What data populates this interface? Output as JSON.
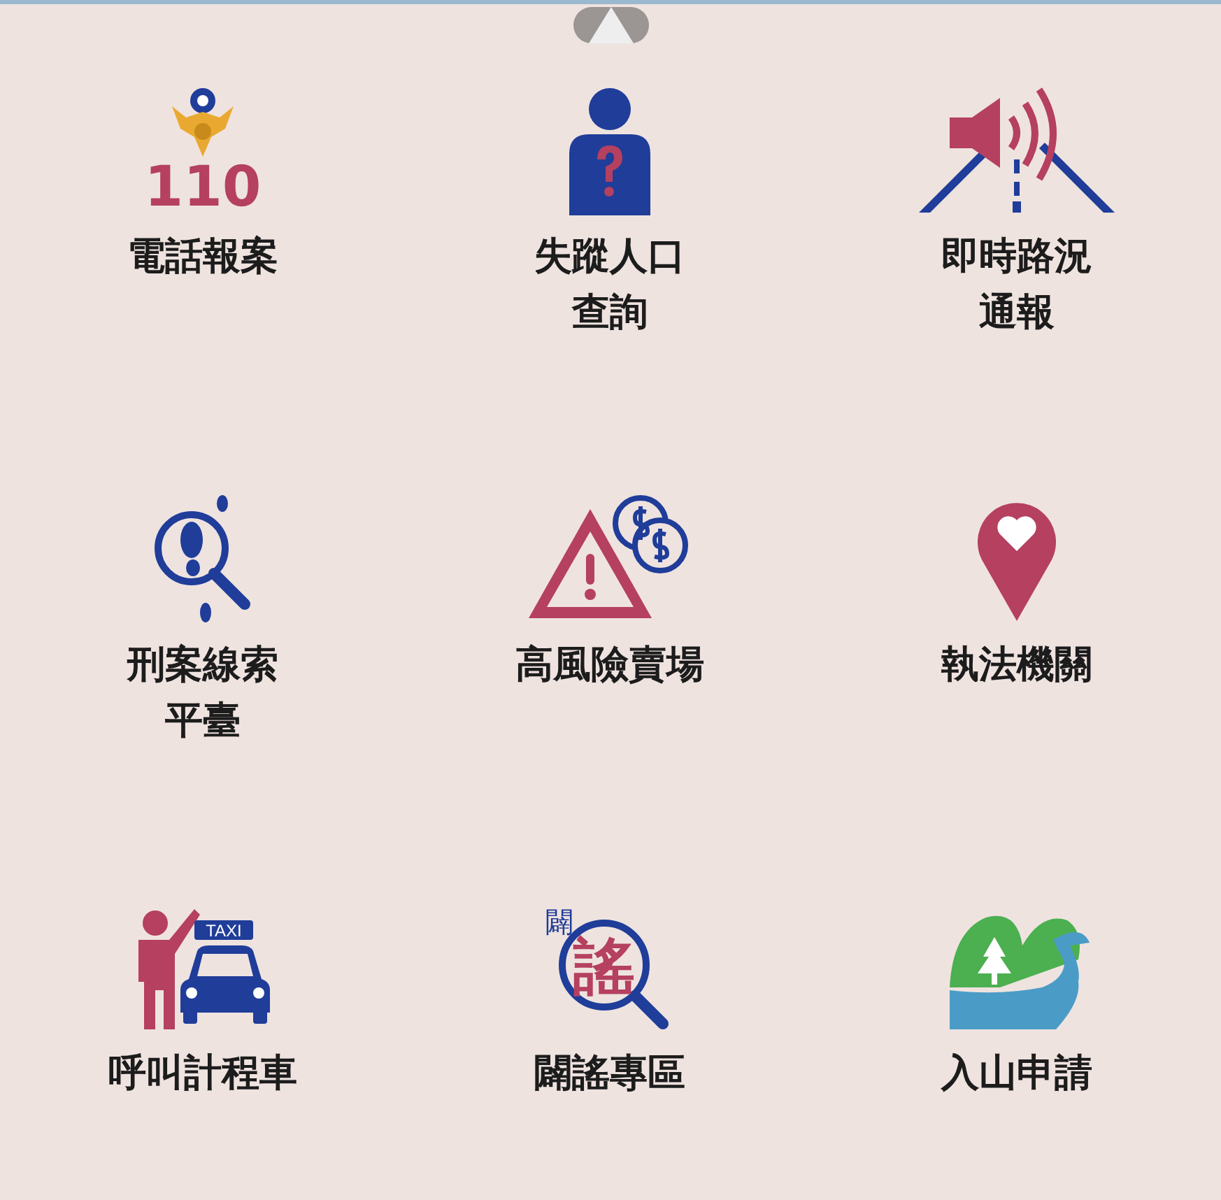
{
  "services": [
    {
      "kind": "police",
      "label": [
        "電話報案"
      ],
      "icon_text": [
        "110"
      ]
    },
    {
      "kind": "missing",
      "label": [
        "失蹤人口",
        "查詢"
      ]
    },
    {
      "kind": "traffic",
      "label": [
        "即時路況",
        "通報"
      ]
    },
    {
      "kind": "clue",
      "label": [
        "刑案線索",
        "平臺"
      ]
    },
    {
      "kind": "risk",
      "label": [
        "高風險賣場"
      ]
    },
    {
      "kind": "location",
      "label": [
        "執法機關"
      ]
    },
    {
      "kind": "taxi",
      "label": [
        "呼叫計程車"
      ],
      "icon_text": [
        "TAXI"
      ]
    },
    {
      "kind": "rumor",
      "label": [
        "闢謠專區"
      ],
      "icon_text": [
        "闢",
        "謠"
      ]
    },
    {
      "kind": "mountain",
      "label": [
        "入山申請"
      ]
    }
  ]
}
